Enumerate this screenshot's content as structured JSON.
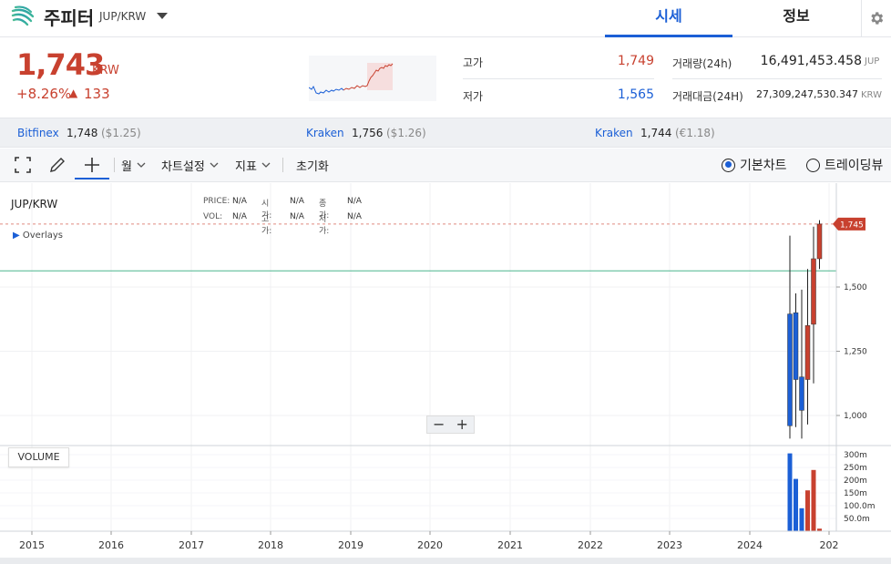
{
  "header": {
    "coin_name": "주피터",
    "pair": "JUP/KRW",
    "tabs": [
      "시세",
      "정보"
    ]
  },
  "summary": {
    "price": "1,743",
    "price_unit": "KRW",
    "change_pct": "+8.26%",
    "change_arrow": "▲",
    "change_amount": "133",
    "stats": {
      "high_label": "고가",
      "high_value": "1,749",
      "low_label": "저가",
      "low_value": "1,565",
      "volume_label": "거래량(24h)",
      "volume_value": "16,491,453.458",
      "volume_unit": "JUP",
      "amount_label": "거래대금(24H)",
      "amount_value": "27,309,247,530.347",
      "amount_unit": "KRW"
    }
  },
  "exchanges": [
    {
      "name": "Bitfinex",
      "price": "1,748",
      "sub": "($1.25)"
    },
    {
      "name": "Kraken",
      "price": "1,756",
      "sub": "($1.26)"
    },
    {
      "name": "Kraken",
      "price": "1,744",
      "sub": "(€1.18)"
    }
  ],
  "toolbar": {
    "period": "월",
    "chart_settings": "차트설정",
    "indicators": "지표",
    "reset": "초기화",
    "radio_basic": "기본차트",
    "radio_tv": "트레이딩뷰"
  },
  "chart": {
    "symbol": "JUP/KRW",
    "overlays": "Overlays",
    "legend": {
      "price_label": "PRICE:",
      "price_val": "N/A",
      "open_label": "시가:",
      "open_val": "N/A",
      "close_label": "종가:",
      "close_val": "N/A",
      "vol_label": "VOL:",
      "vol_val": "N/A",
      "high_label": "고가:",
      "high_val": "N/A",
      "low_label": "저가:",
      "low_val": "N/A"
    },
    "last_price_tag": "1,745",
    "volume_label": "VOLUME",
    "zoom_out": "−",
    "zoom_in": "+"
  },
  "chart_data": {
    "type": "candlestick",
    "price_axis_ticks": [
      "1,500",
      "1,250",
      "1,000"
    ],
    "price_axis_values": [
      1500,
      1250,
      1000
    ],
    "volume_axis_ticks": [
      "300m",
      "250m",
      "200m",
      "150m",
      "100.0m",
      "50.0m"
    ],
    "volume_axis_values": [
      300,
      250,
      200,
      150,
      100,
      50
    ],
    "x_axis_ticks": [
      "2015",
      "2016",
      "2017",
      "2018",
      "2019",
      "2020",
      "2021",
      "2022",
      "2023",
      "2024",
      "202"
    ],
    "horizontal_line": 1563,
    "last_price": 1745,
    "candles": [
      {
        "o": 1395,
        "h": 1700,
        "l": 910,
        "c": 960,
        "up": false
      },
      {
        "o": 1400,
        "h": 1475,
        "l": 955,
        "c": 1140,
        "up": false
      },
      {
        "o": 1150,
        "h": 1490,
        "l": 910,
        "c": 1020,
        "up": false
      },
      {
        "o": 1140,
        "h": 1570,
        "l": 965,
        "c": 1350,
        "up": true
      },
      {
        "o": 1355,
        "h": 1735,
        "l": 1125,
        "c": 1610,
        "up": true
      },
      {
        "o": 1610,
        "h": 1760,
        "l": 1570,
        "c": 1745,
        "up": true
      }
    ],
    "volumes": [
      305,
      205,
      90,
      160,
      240,
      10
    ]
  },
  "colors": {
    "up": "#c8412f",
    "down": "#1b5fd6",
    "accent": "#1b5fd6",
    "hline": "#4bb58d"
  }
}
